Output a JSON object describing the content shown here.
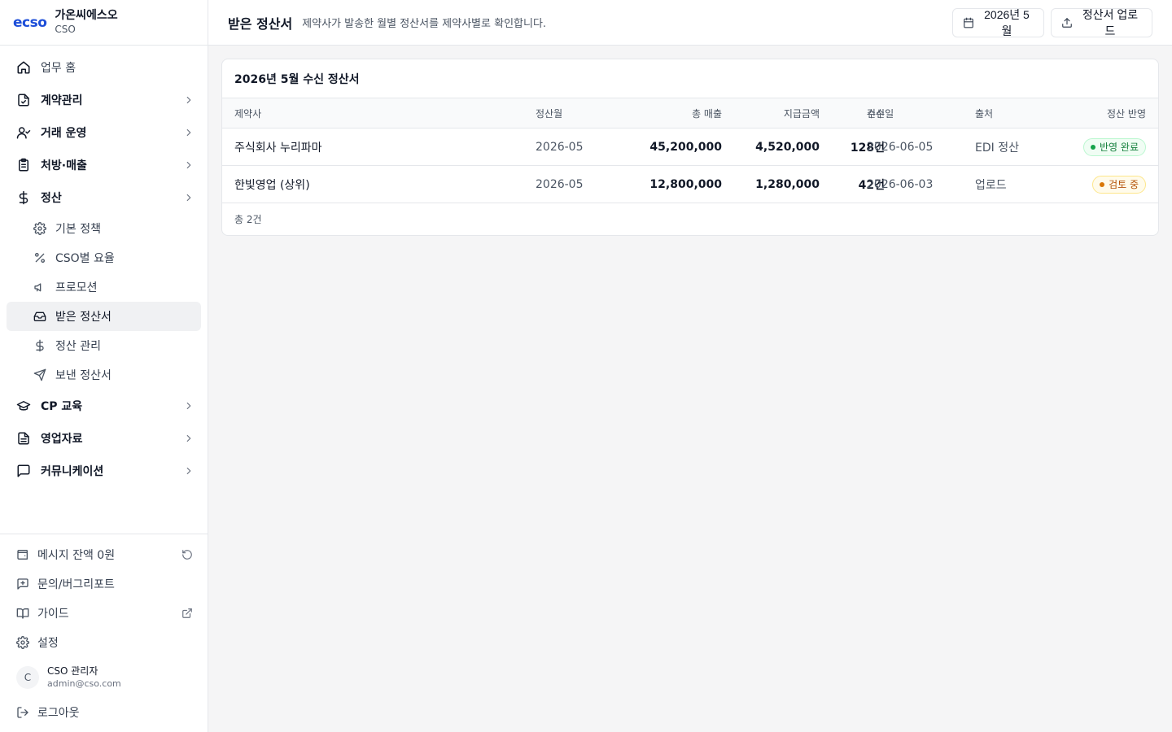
{
  "brand": {
    "logo": "ecso",
    "name": "가온씨에스오",
    "sub": "CSO"
  },
  "nav": {
    "home": "업무 홈",
    "contract": "계약관리",
    "trade": "거래 운영",
    "rx": "처방·매출",
    "settle": "정산",
    "settle_sub": {
      "policy": "기본 정책",
      "rate": "CSO별 요율",
      "promo": "프로모션",
      "received": "받은 정산서",
      "manage": "정산 관리",
      "sent": "보낸 정산서"
    },
    "cp": "CP 교육",
    "sales_material": "영업자료",
    "comm": "커뮤니케이션"
  },
  "footer": {
    "balance": "메시지 잔액 0원",
    "inquiry": "문의/버그리포트",
    "guide": "가이드",
    "settings": "설정",
    "user_initial": "C",
    "user_name": "CSO 관리자",
    "user_email": "admin@cso.com",
    "logout": "로그아웃"
  },
  "header": {
    "title": "받은 정산서",
    "desc": "제약사가 발송한 월별 정산서를 제약사별로 확인합니다.",
    "month_btn": "2026년 5월",
    "upload_btn": "정산서 업로드"
  },
  "card": {
    "title": "2026년 5월 수신 정산서",
    "columns": {
      "company": "제약사",
      "month": "정산월",
      "sales": "총 매출",
      "payment": "지급금액",
      "count": "건수",
      "received": "수신일",
      "source": "출처",
      "status": "정산 반영"
    },
    "rows": [
      {
        "company": "주식회사 누리파마",
        "month": "2026-05",
        "sales": "45,200,000",
        "payment": "4,520,000",
        "count": "128건",
        "received": "2026-06-05",
        "source": "EDI 정산",
        "status": "반영 완료"
      },
      {
        "company": "한빛영업 (상위)",
        "month": "2026-05",
        "sales": "12,800,000",
        "payment": "1,280,000",
        "count": "42건",
        "received": "2026-06-03",
        "source": "업로드",
        "status": "검토 중"
      }
    ],
    "total": "총 2건"
  },
  "colors": {
    "accent": "#1d4ed8",
    "done": "#15803d",
    "review": "#b45309"
  }
}
